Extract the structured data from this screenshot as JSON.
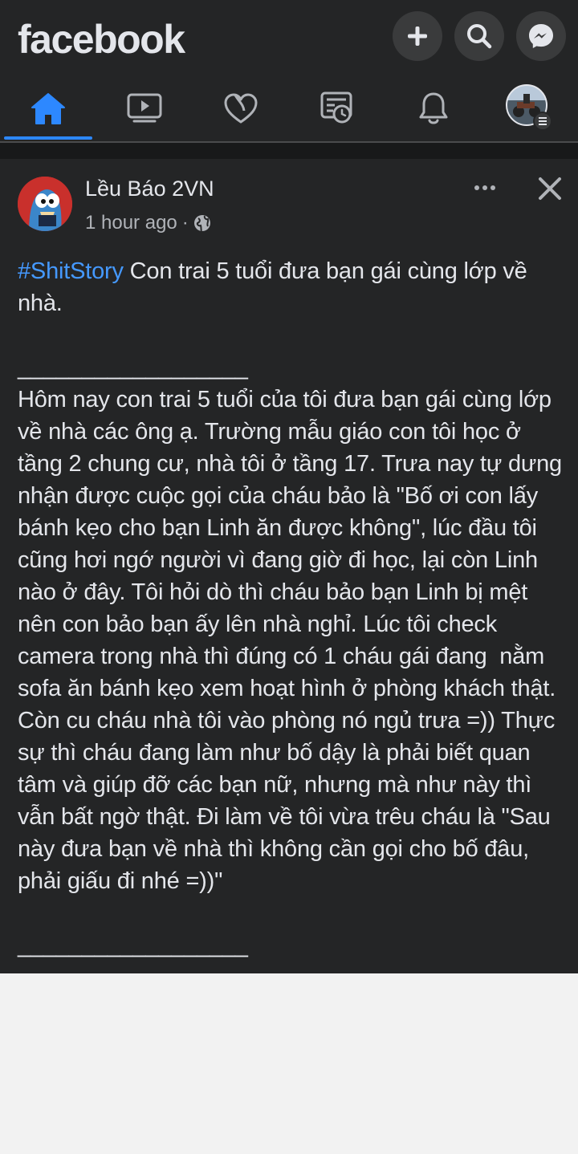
{
  "app": {
    "brand": "facebook"
  },
  "header": {
    "buttons": [
      {
        "name": "create-button",
        "icon": "plus-icon"
      },
      {
        "name": "search-button",
        "icon": "search-icon"
      },
      {
        "name": "messenger-button",
        "icon": "messenger-icon"
      }
    ]
  },
  "nav": {
    "active": "home",
    "items": [
      {
        "id": "home",
        "icon": "home-icon"
      },
      {
        "id": "watch",
        "icon": "video-icon"
      },
      {
        "id": "dating",
        "icon": "heart-icon"
      },
      {
        "id": "pages",
        "icon": "news-icon"
      },
      {
        "id": "notifications",
        "icon": "bell-icon"
      },
      {
        "id": "menu",
        "icon": "profile-menu-icon"
      }
    ],
    "accent_color": "#2d88ff"
  },
  "post": {
    "author": "Lều Báo 2VN",
    "time": "1 hour ago",
    "separator": "·",
    "privacy_icon": "globe-icon",
    "hashtag": "#ShitStory",
    "headline": " Con trai 5 tuổi đưa bạn gái cùng lớp về nhà.",
    "body": "\n\n__________________\nHôm nay con trai 5 tuổi của tôi đưa bạn gái cùng lớp về nhà các ông ạ. Trường mẫu giáo con tôi học ở tầng 2 chung cư, nhà tôi ở tầng 17. Trưa nay tự dưng nhận được cuộc gọi của cháu bảo là \"Bố ơi con lấy bánh kẹo cho bạn Linh ăn được không\", lúc đầu tôi cũng hơi ngớ người vì đang giờ đi học, lại còn Linh nào ở đây. Tôi hỏi dò thì cháu bảo bạn Linh bị mệt nên con bảo bạn ấy lên nhà nghỉ. Lúc tôi check camera trong nhà thì đúng có 1 cháu gái đang  nằm sofa ăn bánh kẹo xem hoạt hình ở phòng khách thật. Còn cu cháu nhà tôi vào phòng nó ngủ trưa =)) Thực sự thì cháu đang làm như bố dậy là phải biết quan tâm và giúp đỡ các bạn nữ, nhưng mà như này thì vẫn bất ngờ thật. Đi làm về tôi vừa trêu cháu là \"Sau này đưa bạn về nhà thì không cần gọi cho bố đâu, phải giấu đi nhé =))\"\n\n__________________",
    "hashtag_color": "#4599ff"
  }
}
